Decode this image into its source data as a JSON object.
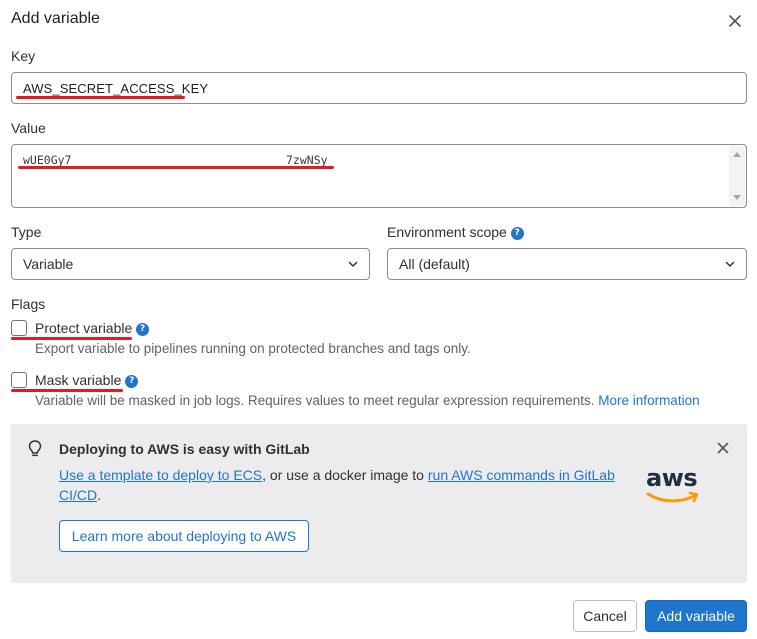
{
  "modal": {
    "title": "Add variable"
  },
  "key": {
    "label": "Key",
    "value": "AWS_SECRET_ACCESS_KEY"
  },
  "value_field": {
    "label": "Value",
    "value_start": "wUE0Gy7",
    "value_end": "7zwNSy"
  },
  "type": {
    "label": "Type",
    "selected": "Variable"
  },
  "env_scope": {
    "label": "Environment scope",
    "selected": "All (default)"
  },
  "flags": {
    "label": "Flags",
    "protect": {
      "label": "Protect variable",
      "help": "Export variable to pipelines running on protected branches and tags only.",
      "checked": false
    },
    "mask": {
      "label": "Mask variable",
      "help": "Variable will be masked in job logs. Requires values to meet regular expression requirements.",
      "link": "More information",
      "checked": false
    }
  },
  "alert": {
    "title": "Deploying to AWS is easy with GitLab",
    "link1": "Use a template to deploy to ECS",
    "text_mid": ", or use a docker image to ",
    "link2": "run AWS commands in GitLab CI/CD",
    "text_end": ".",
    "button": "Learn more about deploying to AWS",
    "logo_text": "aws"
  },
  "footer": {
    "cancel": "Cancel",
    "add": "Add variable"
  },
  "colors": {
    "accent": "#1f75cb",
    "redline": "#e01b24",
    "alert_bg": "#ececef"
  }
}
